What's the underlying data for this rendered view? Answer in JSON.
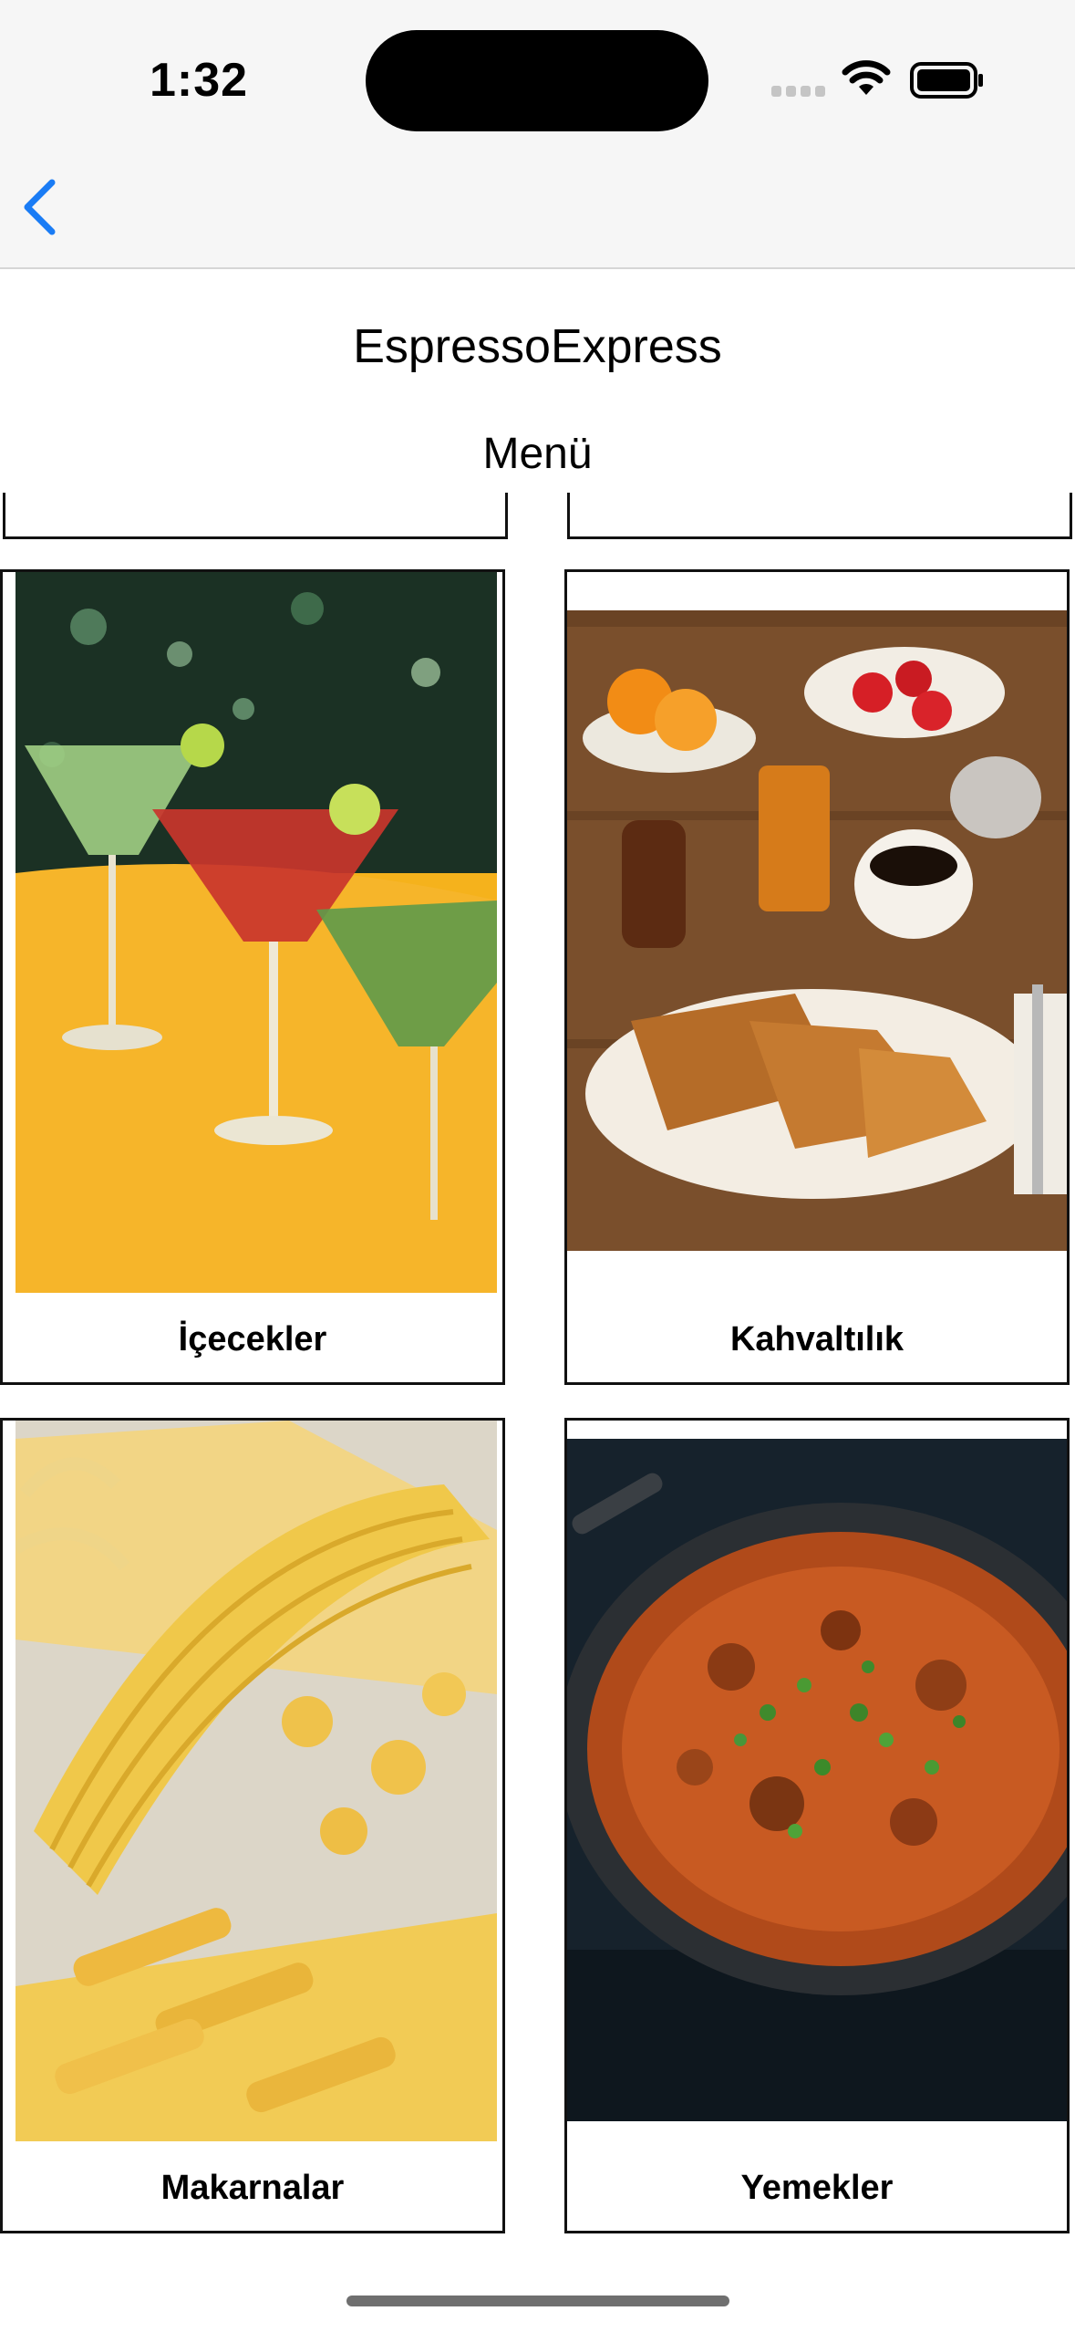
{
  "status_bar": {
    "time": "1:32"
  },
  "nav": {
    "back_icon": "chevron-left-icon"
  },
  "header": {
    "title": "EspressoExpress",
    "subtitle": "Menü"
  },
  "menu": {
    "items": [
      {
        "label": "İçecekler",
        "image": "cocktails-photo"
      },
      {
        "label": "Kahvaltılık",
        "image": "breakfast-photo"
      },
      {
        "label": "Makarnalar",
        "image": "pasta-photo"
      },
      {
        "label": "Yemekler",
        "image": "curry-pan-photo"
      }
    ]
  },
  "colors": {
    "accent": "#1a7cf5",
    "card_border": "#111111",
    "topbar_bg": "#f6f6f6"
  }
}
